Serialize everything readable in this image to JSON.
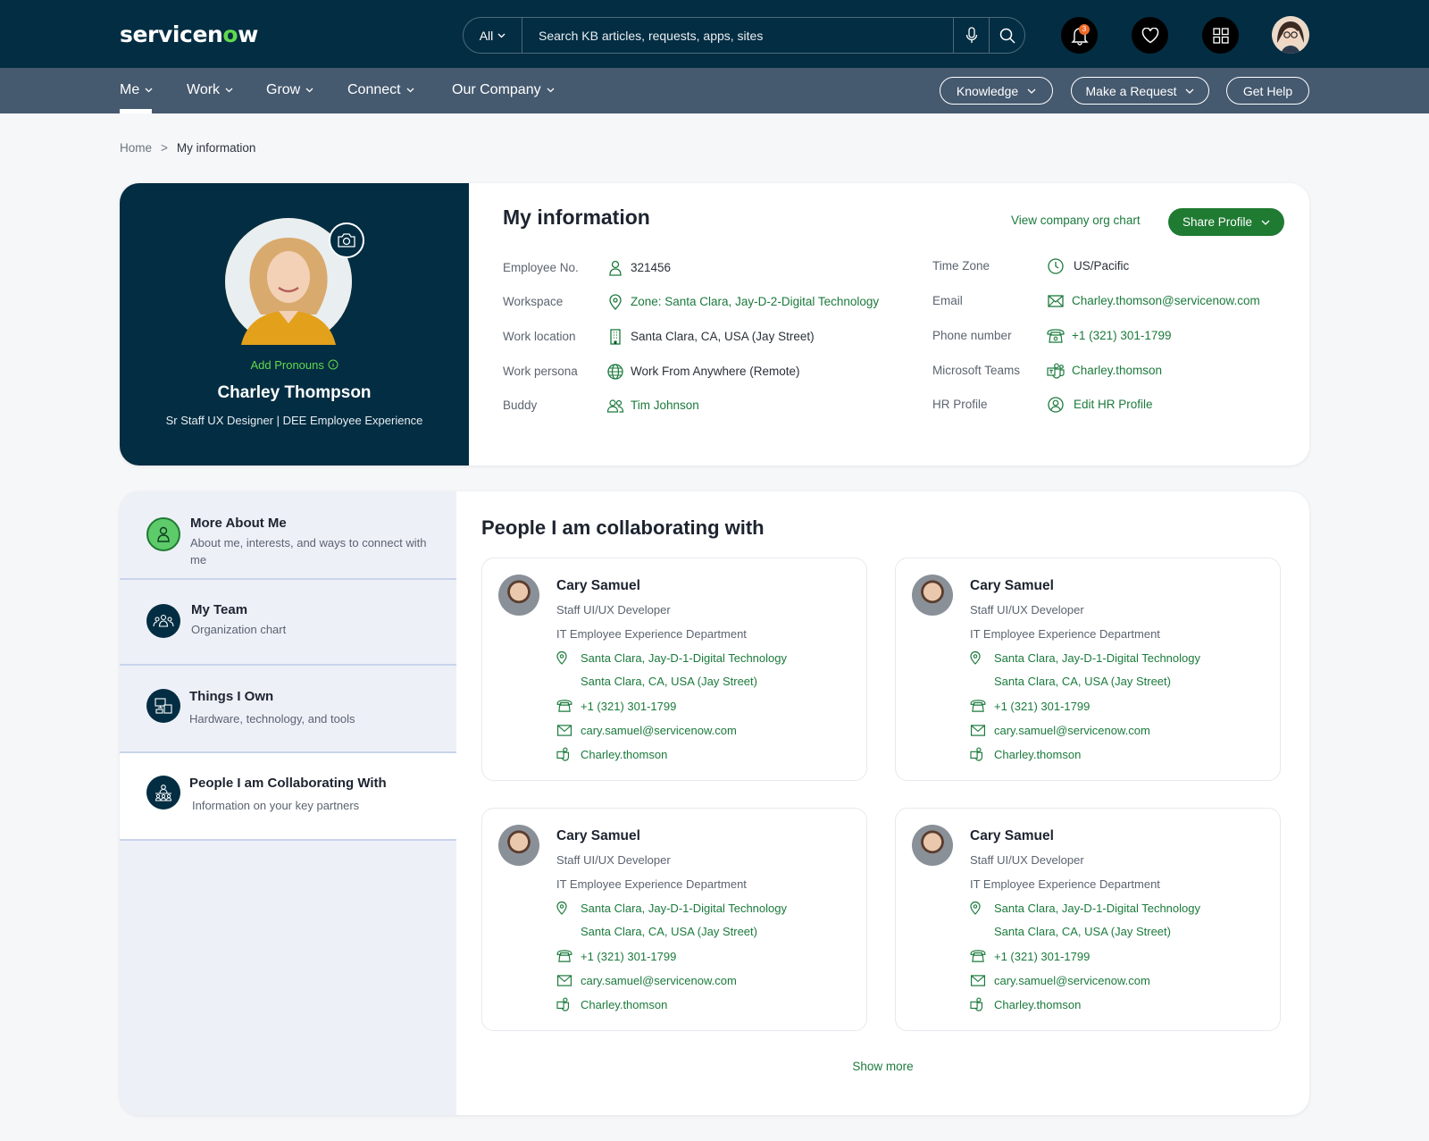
{
  "header": {
    "logo_text_a": "servicen",
    "logo_text_o": "o",
    "logo_text_b": "w",
    "search_scope": "All",
    "search_placeholder": "Search KB articles, requests, apps, sites",
    "notification_count": "3"
  },
  "nav": {
    "items": [
      {
        "label": "Me"
      },
      {
        "label": "Work"
      },
      {
        "label": "Grow"
      },
      {
        "label": "Connect"
      },
      {
        "label": "Our Company"
      }
    ],
    "buttons": {
      "knowledge": "Knowledge",
      "make_request": "Make a Request",
      "get_help": "Get Help"
    }
  },
  "breadcrumb": {
    "home": "Home",
    "separator": ">",
    "current": "My information"
  },
  "profile": {
    "add_pronouns": "Add Pronouns",
    "name": "Charley Thompson",
    "title": "Sr Staff UX Designer | DEE Employee Experience"
  },
  "info": {
    "title": "My information",
    "org_chart_link": "View company org chart",
    "share_button": "Share Profile",
    "left_fields": [
      {
        "label": "Employee No.",
        "value": "321456"
      },
      {
        "label": "Workspace",
        "value": "Zone: Santa Clara, Jay-D-2-Digital Technology"
      },
      {
        "label": "Work location",
        "value": "Santa Clara, CA, USA (Jay Street)"
      },
      {
        "label": "Work persona",
        "value": "Work From Anywhere (Remote)"
      },
      {
        "label": "Buddy",
        "value": "Tim Johnson"
      }
    ],
    "right_fields": [
      {
        "label": "Time Zone",
        "value": "US/Pacific"
      },
      {
        "label": "Email",
        "value": "Charley.thomson@servicenow.com"
      },
      {
        "label": "Phone number",
        "value": "+1 (321) 301-1799"
      },
      {
        "label": "Microsoft Teams",
        "value": "Charley.thomson"
      },
      {
        "label": "HR Profile",
        "value": "Edit HR Profile"
      }
    ]
  },
  "sidebar": {
    "items": [
      {
        "title": "More About Me",
        "subtitle": "About me, interests, and ways to connect with me"
      },
      {
        "title": "My Team",
        "subtitle": "Organization chart"
      },
      {
        "title": "Things I Own",
        "subtitle": "Hardware, technology, and tools"
      },
      {
        "title": "People I am Collaborating With",
        "subtitle": "Information on your key partners"
      }
    ]
  },
  "collaborators": {
    "title": "People I am collaborating with",
    "show_more": "Show more",
    "people": [
      {
        "name": "Cary Samuel",
        "role": "Staff UI/UX Developer",
        "department": "IT Employee Experience Department",
        "workspace": "Santa Clara, Jay-D-1-Digital Technology",
        "location": "Santa Clara, CA, USA (Jay Street)",
        "phone": "+1 (321) 301-1799",
        "email": "cary.samuel@servicenow.com",
        "teams": "Charley.thomson"
      },
      {
        "name": "Cary Samuel",
        "role": "Staff UI/UX Developer",
        "department": "IT Employee Experience Department",
        "workspace": "Santa Clara, Jay-D-1-Digital Technology",
        "location": "Santa Clara, CA, USA (Jay Street)",
        "phone": "+1 (321) 301-1799",
        "email": "cary.samuel@servicenow.com",
        "teams": "Charley.thomson"
      },
      {
        "name": "Cary Samuel",
        "role": "Staff UI/UX Developer",
        "department": "IT Employee Experience Department",
        "workspace": "Santa Clara, Jay-D-1-Digital Technology",
        "location": "Santa Clara, CA, USA (Jay Street)",
        "phone": "+1 (321) 301-1799",
        "email": "cary.samuel@servicenow.com",
        "teams": "Charley.thomson"
      },
      {
        "name": "Cary Samuel",
        "role": "Staff UI/UX Developer",
        "department": "IT Employee Experience Department",
        "workspace": "Santa Clara, Jay-D-1-Digital Technology",
        "location": "Santa Clara, CA, USA (Jay Street)",
        "phone": "+1 (321) 301-1799",
        "email": "cary.samuel@servicenow.com",
        "teams": "Charley.thomson"
      }
    ]
  },
  "colors": {
    "header_bg": "#032d42",
    "nav_bg": "#45596f",
    "accent_green": "#1b7a3c",
    "brand_green": "#62d84e",
    "badge": "#f06a28"
  }
}
